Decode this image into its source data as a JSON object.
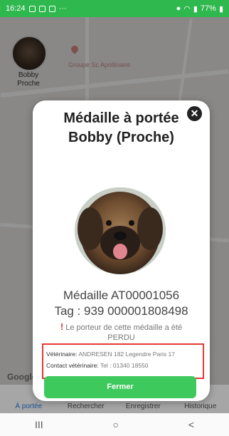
{
  "status_bar": {
    "time": "16:24",
    "battery": "77%"
  },
  "map": {
    "pet_marker_label": "Bobby\nProche",
    "poi_label": "Groupe Sc Apollinaire",
    "attribution": "Google"
  },
  "modal": {
    "title": "Médaille à portée Bobby (Proche)",
    "close_label": "✕",
    "medal_id": "Médaille AT00001056",
    "tag": "Tag : 939 000001808498",
    "lost_icon": "!",
    "lost_message": "Le porteur de cette médaille a été PERDU",
    "vet_label": "Vétérinaire:",
    "vet_value": "ANDRESEN 182 Legendre Paris 17",
    "vet_contact_label": "Contact vétérinaire:",
    "vet_contact_value": "Tel : 01340 18550",
    "close_button": "Fermer"
  },
  "tabs": [
    {
      "label": "À portée"
    },
    {
      "label": "Rechercher"
    },
    {
      "label": "Enregistrer"
    },
    {
      "label": "Historique"
    }
  ],
  "nav": {
    "recents": "III",
    "home": "○",
    "back": "<"
  },
  "colors": {
    "status_bar": "#2eb84e",
    "button": "#3ec95c",
    "highlight_border": "#e53935"
  }
}
